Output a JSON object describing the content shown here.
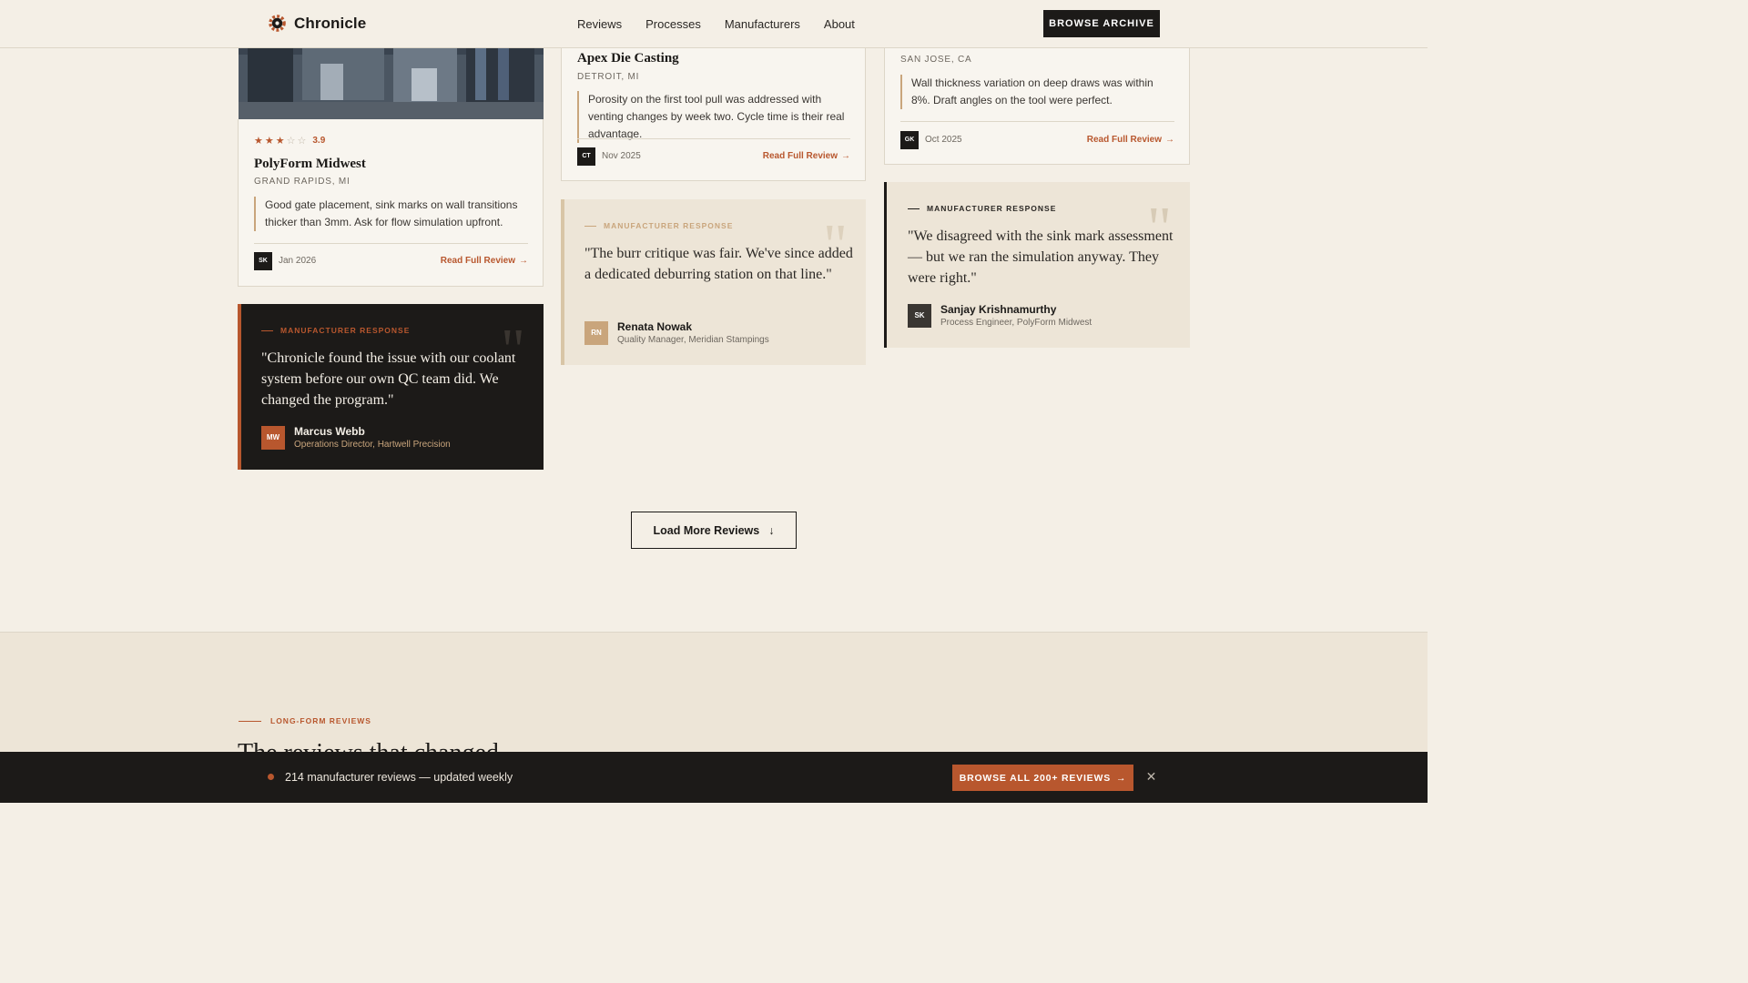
{
  "header": {
    "brand": "Chronicle",
    "nav": [
      "Reviews",
      "Processes",
      "Manufacturers",
      "About"
    ],
    "cta": "BROWSE ARCHIVE"
  },
  "cards": [
    {
      "rating": "3.9",
      "stars_filled": 3,
      "stars_total": 5,
      "name": "PolyForm Midwest",
      "location": "GRAND RAPIDS, MI",
      "quote": "Good gate placement, sink marks on wall transitions thicker than 3mm. Ask for flow simulation upfront.",
      "initials": "SK",
      "date": "Jan 2026",
      "link": "Read Full Review"
    },
    {
      "name": "Apex Die Casting",
      "location": "DETROIT, MI",
      "quote": "Porosity on the first tool pull was addressed with venting changes by week two. Cycle time is their real advantage.",
      "initials": "CT",
      "date": "Nov 2025",
      "link": "Read Full Review"
    },
    {
      "location": "SAN JOSE, CA",
      "quote": "Wall thickness variation on deep draws was within 8%. Draft angles on the tool were perfect.",
      "initials": "GK",
      "date": "Oct 2025",
      "link": "Read Full Review"
    }
  ],
  "responses": [
    {
      "label": "MANUFACTURER RESPONSE",
      "quote": "\"Chronicle found the issue with our coolant system before our own QC team did. We changed the program.\"",
      "initials": "MW",
      "name": "Marcus Webb",
      "role": "Operations Director, Hartwell Precision"
    },
    {
      "label": "MANUFACTURER RESPONSE",
      "quote": "\"The burr critique was fair. We've since added a dedicated deburring station on that line.\"",
      "initials": "RN",
      "name": "Renata Nowak",
      "role": "Quality Manager, Meridian Stampings"
    },
    {
      "label": "MANUFACTURER RESPONSE",
      "quote": "\"We disagreed with the sink mark assessment — but we ran the simulation anyway. They were right.\"",
      "initials": "SK",
      "name": "Sanjay Krishnamurthy",
      "role": "Process Engineer, PolyForm Midwest"
    }
  ],
  "load_more": "Load More Reviews",
  "long_form": {
    "label": "LONG-FORM REVIEWS",
    "title": "The reviews that changed"
  },
  "bottom_bar": {
    "text": "214 manufacturer reviews — updated weekly",
    "cta": "BROWSE ALL 200+ REVIEWS"
  },
  "colors": {
    "accent": "#b8572e",
    "dark": "#1c1a18",
    "background": "#f4efe6",
    "tan": "#c9a57c"
  }
}
